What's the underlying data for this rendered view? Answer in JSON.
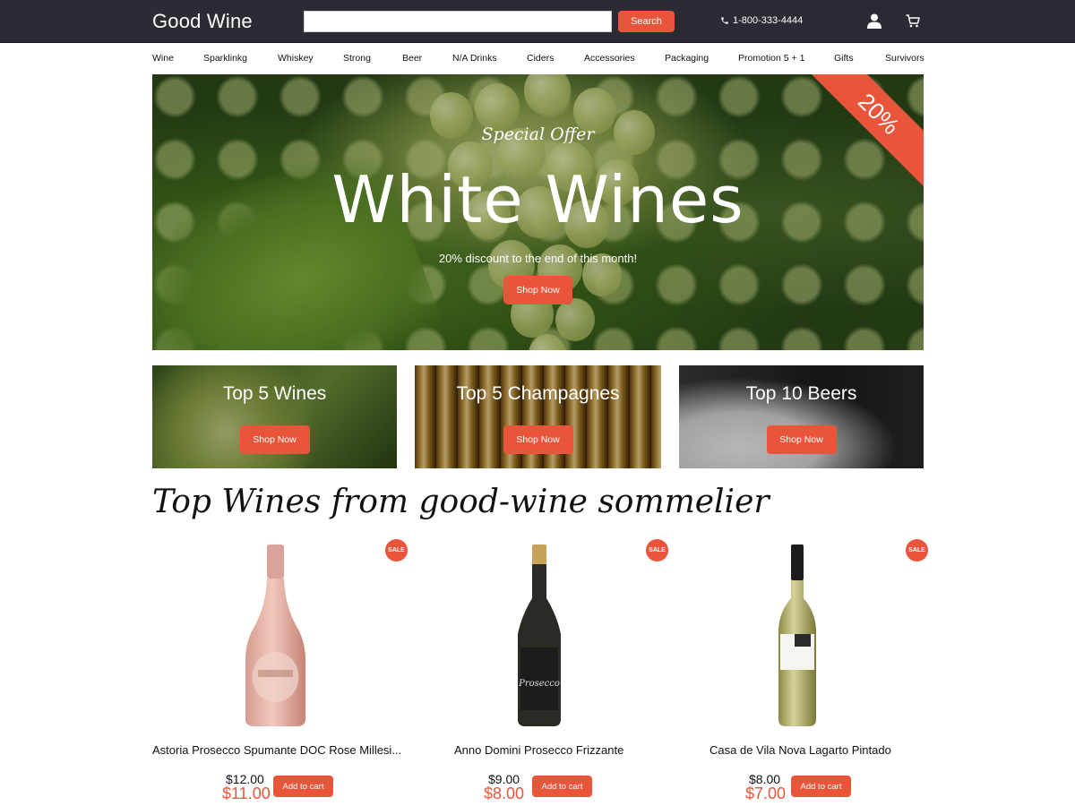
{
  "header": {
    "logo": "Good Wine",
    "search_placeholder": "",
    "search_button": "Search",
    "phone": "1-800-333-4444",
    "icons": [
      "phone-icon",
      "user-icon",
      "cart-icon"
    ]
  },
  "nav": {
    "items": [
      "Wine",
      "Sparklinkg",
      "Whiskey",
      "Strong",
      "Beer",
      "N/A Drinks",
      "Ciders",
      "Accessories",
      "Packaging",
      "Promotion 5 + 1",
      "Gifts",
      "Survivors"
    ]
  },
  "hero": {
    "subtitle": "Special Offer",
    "title": "White Wines",
    "caption": "20% discount to the end of this month!",
    "button": "Shop Now",
    "ribbon": "20%"
  },
  "categories": [
    {
      "title": "Top 5 Wines",
      "button": "Shop Now"
    },
    {
      "title": "Top 5 Champagnes",
      "button": "Shop Now"
    },
    {
      "title": "Top 10 Beers",
      "button": "Shop Now"
    }
  ],
  "section_title": "Top Wines from good-wine sommelier",
  "products": [
    {
      "badge": "SALE",
      "name": "Astoria Prosecco Spumante DOC Rose Millesi...",
      "old_price": "$12.00",
      "new_price": "$11.00",
      "button": "Add to cart"
    },
    {
      "badge": "SALE",
      "name": "Anno Domini Prosecco Frizzante",
      "old_price": "$9.00",
      "new_price": "$8.00",
      "button": "Add to cart"
    },
    {
      "badge": "SALE",
      "name": "Casa de Vila Nova Lagarto Pintado",
      "old_price": "$8.00",
      "new_price": "$7.00",
      "button": "Add to cart"
    }
  ],
  "colors": {
    "header_bg": "#2c2a33",
    "accent": "#e8553a",
    "text": "#111111",
    "background": "#ffffff"
  }
}
